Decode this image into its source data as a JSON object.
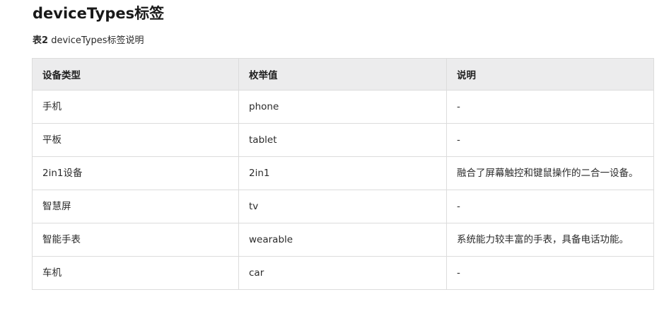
{
  "heading": "deviceTypes标签",
  "caption": {
    "number": "表2",
    "text": "deviceTypes标签说明"
  },
  "table": {
    "headers": [
      "设备类型",
      "枚举值",
      "说明"
    ],
    "rows": [
      [
        "手机",
        "phone",
        "-"
      ],
      [
        "平板",
        "tablet",
        "-"
      ],
      [
        "2in1设备",
        "2in1",
        "融合了屏幕触控和键鼠操作的二合一设备。"
      ],
      [
        "智慧屏",
        "tv",
        "-"
      ],
      [
        "智能手表",
        "wearable",
        "系统能力较丰富的手表，具备电话功能。"
      ],
      [
        "车机",
        "car",
        "-"
      ]
    ]
  }
}
